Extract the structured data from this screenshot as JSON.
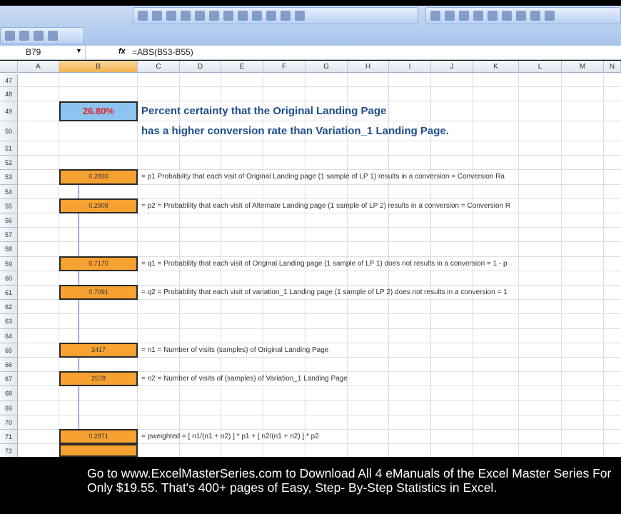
{
  "formula_bar": {
    "name_box": "B79",
    "fx": "fx",
    "formula": "=ABS(B53-B55)"
  },
  "columns": [
    "A",
    "B",
    "C",
    "D",
    "E",
    "F",
    "G",
    "H",
    "I",
    "J",
    "K",
    "L",
    "M",
    "N"
  ],
  "selected_column": "B",
  "rows": [
    "47",
    "48",
    "49",
    "50",
    "51",
    "52",
    "53",
    "54",
    "55",
    "56",
    "57",
    "58",
    "59",
    "60",
    "61",
    "62",
    "63",
    "64",
    "65",
    "66",
    "67",
    "68",
    "69",
    "70",
    "71",
    "72"
  ],
  "result": {
    "row": "49",
    "value": "26.80%"
  },
  "headline": {
    "line1": "Percent certainty that the Original Landing Page",
    "line2": "has a higher conversion rate than Variation_1 Landing Page."
  },
  "cells": [
    {
      "row": "53",
      "value": "0.2830",
      "desc": "= p1 Probability that each visit of Original Landing page (1 sample of LP 1) results in a conversion = Conversion Ra"
    },
    {
      "row": "55",
      "value": "0.2909",
      "desc": "= p2 = Probability that each visit of Alternate Landing page (1 sample of LP 2) results in a conversion = Conversion R"
    },
    {
      "row": "59",
      "value": "0.7170",
      "desc": "= q1 = Probability that each visit of Original Landing page (1 sample of LP 1) does not results in a conversion =  1 - p"
    },
    {
      "row": "61",
      "value": "0.7091",
      "desc": "= q2 = Probability that each visit of variation_1 Landing page (1 sample of LP 2) does not results in a conversion =  1"
    },
    {
      "row": "65",
      "value": "2417",
      "desc": "= n1 = Number of visits (samples) of Original Landing Page"
    },
    {
      "row": "67",
      "value": "2578",
      "desc": "= n2 = Number of visits of (samples) of Variation_1 Landing Page"
    },
    {
      "row": "71",
      "value": "0.2871",
      "desc": "= pweighted  =   [ n1/(n1 + n2) ] * p1  +   [ n2/(n1 + n2) ] * p2"
    }
  ],
  "caption": "Go to www.ExcelMasterSeries.com to Download All 4 eManuals of the Excel Master Series For Only $19.55. That's 400+ pages of Easy, Step- By-Step Statistics in Excel."
}
